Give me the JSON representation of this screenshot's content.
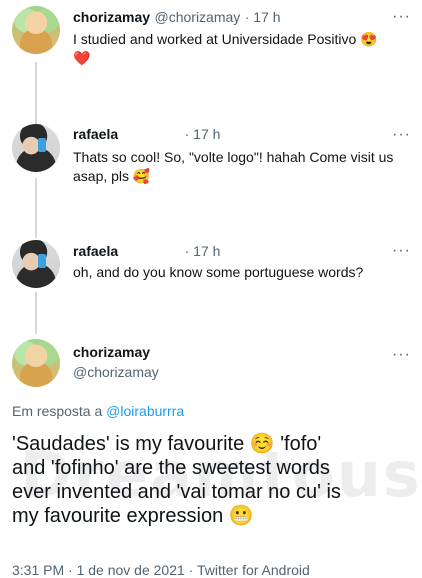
{
  "tweets": [
    {
      "name": "chorizamay",
      "handle": "@chorizamay",
      "time": "· 17 h",
      "text": "I studied and worked at Universidade Positivo 😍",
      "trailing_emoji": "❤️"
    },
    {
      "name": "rafaela",
      "time": "· 17 h",
      "text": "Thats so cool! So, \"volte logo\"! hahah Come visit us asap, pls 🥰"
    },
    {
      "name": "rafaela",
      "time": "· 17 h",
      "text": "oh, and do you know some portuguese words?"
    }
  ],
  "main_tweet": {
    "name": "chorizamay",
    "handle": "@chorizamay",
    "reply_prefix": "Em resposta a",
    "reply_to": "@loirabu rrra",
    "reply_to_display": "@loiraburrra",
    "text_line1": "'Saudades' is my favourite ☺️ 'fofo'",
    "text_line2": "and 'fofinho' are the sweetest words",
    "text_line3": "ever invented and 'vai tomar no cu' is",
    "text_line4": "my favourite expression 😬",
    "meta": "3:31 PM · 1 de nov de 2021 · Twitter for Android"
  },
  "watermark": "Dreamtous",
  "more_glyph": "···"
}
